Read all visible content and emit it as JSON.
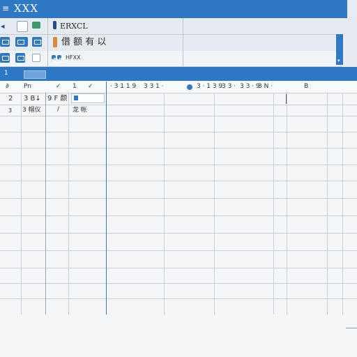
{
  "titlebar": {
    "menu_glyph": "≡",
    "title": "XXX"
  },
  "ribbon": {
    "row1_label": "ERXCL",
    "row2_label": "借 额 有 以",
    "row3_label": "HFXX"
  },
  "band": {
    "label": "1"
  },
  "header": {
    "col_a": "∂",
    "col_b": "Pn",
    "check1": "✓",
    "num1": "1",
    "check2": "✓",
    "range1": "· 3 1 1 9",
    "range2": "3 3 1 ·",
    "range3": "3 · 1 3 9",
    "range4": "3 3 ·",
    "range5": "3 3 · 9",
    "range6": "3 N ·",
    "col_last": "B"
  },
  "subheader": {
    "r1_a": "2",
    "r1_b": "3 B↓",
    "r1_c": "9 F 颜",
    "r2_a": "3",
    "r2_b": "3 帽仪",
    "r2_c": "/",
    "r2_d": "龙 帐"
  },
  "colors": {
    "accent": "#2f78c4",
    "grid": "#c8cfd8",
    "grid_dark": "#3d73b0"
  }
}
